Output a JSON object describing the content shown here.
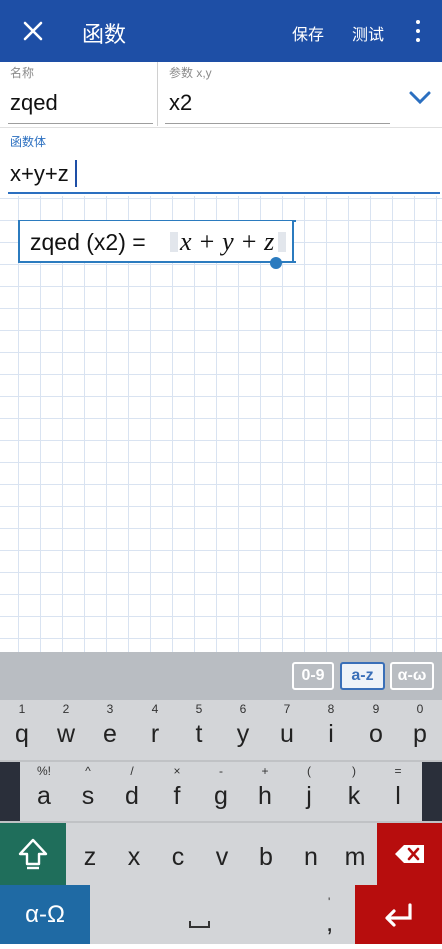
{
  "header": {
    "title": "函数",
    "save_label": "保存",
    "test_label": "测试",
    "colors": {
      "bar": "#1E4FA6",
      "accent": "#2b7bbf"
    },
    "icons": {
      "close": "close-icon",
      "more": "more-vert-icon"
    }
  },
  "form": {
    "name_label": "名称",
    "name_value": "zqed",
    "params_label": "参数 x,y",
    "params_value": "x2",
    "body_label": "函数体",
    "body_value": "x+y+z"
  },
  "formula": {
    "left": "zqed (x2) =",
    "right": "x + y + z"
  },
  "keyboard": {
    "modes": [
      "0-9",
      "a-z",
      "α-ω"
    ],
    "active_mode": "a-z",
    "row1": {
      "hints": [
        "1",
        "2",
        "3",
        "4",
        "5",
        "6",
        "7",
        "8",
        "9",
        "0"
      ],
      "keys": [
        "q",
        "w",
        "e",
        "r",
        "t",
        "y",
        "u",
        "i",
        "o",
        "p"
      ]
    },
    "row2": {
      "hints": [
        "%!",
        "^",
        "/",
        "×",
        "-",
        "+",
        "(",
        ")",
        "="
      ],
      "keys": [
        "a",
        "s",
        "d",
        "f",
        "g",
        "h",
        "j",
        "k",
        "l"
      ]
    },
    "row3": {
      "keys": [
        "z",
        "x",
        "c",
        "v",
        "b",
        "n",
        "m"
      ]
    },
    "greek_label": "α-Ω",
    "comma_label": ",",
    "comma_hint": "'",
    "icons": {
      "shift": "shift-icon",
      "backspace": "backspace-icon",
      "space": "space-icon",
      "enter": "enter-icon"
    },
    "colors": {
      "shift": "#1f6e5b",
      "backspace": "#b70d0d",
      "greek": "#1f6aa4",
      "enter": "#b70d0d"
    }
  }
}
